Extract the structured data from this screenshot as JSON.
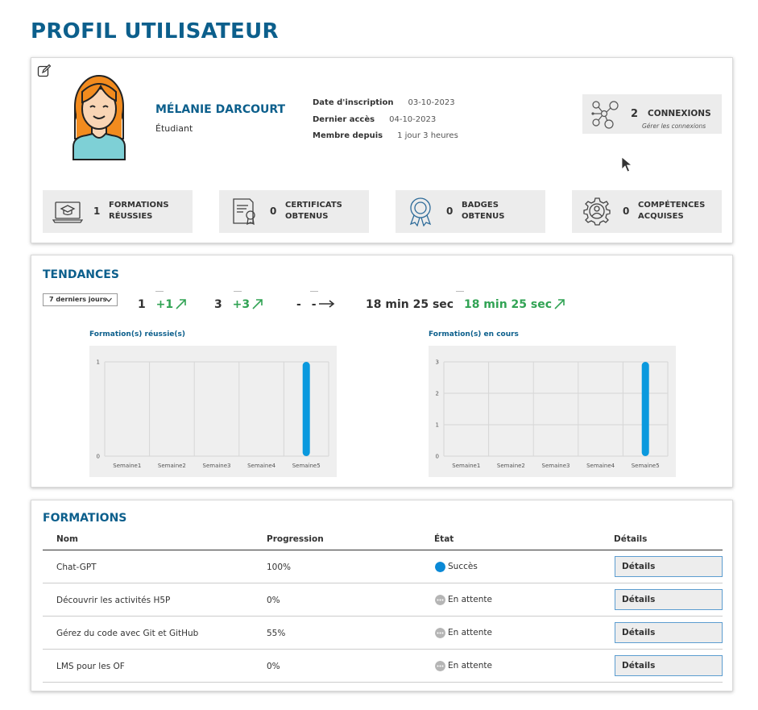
{
  "page": {
    "title": "PROFIL UTILISATEUR"
  },
  "profile": {
    "name": "MÉLANIE DARCOURT",
    "role": "Étudiant",
    "info": [
      {
        "label": "Date d'inscription",
        "value": "03-10-2023"
      },
      {
        "label": "Dernier accès",
        "value": "04-10-2023"
      },
      {
        "label": "Membre depuis",
        "value": "1 jour 3 heures"
      }
    ],
    "connections": {
      "count": "2",
      "label": "CONNEXIONS",
      "manage": "Gérer les connexions"
    }
  },
  "stats": [
    {
      "value": "1",
      "label": "Formations réussies",
      "icon": "laptop-graduation-icon"
    },
    {
      "value": "0",
      "label": "Certificats obtenus",
      "icon": "certificate-icon"
    },
    {
      "value": "0",
      "label": "Badges obtenus",
      "icon": "badge-ribbon-icon"
    },
    {
      "value": "0",
      "label": "Compétences acquises",
      "icon": "gear-person-icon"
    }
  ],
  "trends": {
    "title": "TENDANCES",
    "period": "7 derniers jours",
    "items": [
      {
        "value": "1",
        "delta": "+1"
      },
      {
        "value": "3",
        "delta": "+3"
      },
      {
        "value": "-",
        "delta": "-"
      },
      {
        "value": "18 min 25 sec",
        "delta": "18 min 25 sec"
      }
    ]
  },
  "chart_data": [
    {
      "type": "bar",
      "title": "Formation(s) réussie(s)",
      "categories": [
        "Semaine1",
        "Semaine2",
        "Semaine3",
        "Semaine4",
        "Semaine5"
      ],
      "values": [
        0,
        0,
        0,
        0,
        1
      ],
      "ylim": [
        0,
        1
      ],
      "yticks": [
        0,
        1
      ],
      "grid": true,
      "bar_color": "#0a99de"
    },
    {
      "type": "bar",
      "title": "Formation(s) en cours",
      "categories": [
        "Semaine1",
        "Semaine2",
        "Semaine3",
        "Semaine4",
        "Semaine5"
      ],
      "values": [
        0,
        0,
        0,
        0,
        3
      ],
      "ylim": [
        0,
        3
      ],
      "yticks": [
        0,
        1,
        2,
        3
      ],
      "grid": true,
      "bar_color": "#0a99de"
    }
  ],
  "formations": {
    "title": "FORMATIONS",
    "headers": {
      "name": "Nom",
      "progress": "Progression",
      "state": "État",
      "details": "Détails"
    },
    "rows": [
      {
        "name": "Chat-GPT",
        "progress": "100%",
        "state": "Succès",
        "state_color": "#0a89d6",
        "details": "Détails"
      },
      {
        "name": "Découvrir les activités H5P",
        "progress": "0%",
        "state": "En attente",
        "state_color": "#b5b5b5",
        "details": "Détails"
      },
      {
        "name": "Gérez du code avec Git et GitHub",
        "progress": "55%",
        "state": "En attente",
        "state_color": "#b5b5b5",
        "details": "Détails"
      },
      {
        "name": "LMS pour les OF",
        "progress": "0%",
        "state": "En attente",
        "state_color": "#b5b5b5",
        "details": "Détails"
      }
    ]
  }
}
